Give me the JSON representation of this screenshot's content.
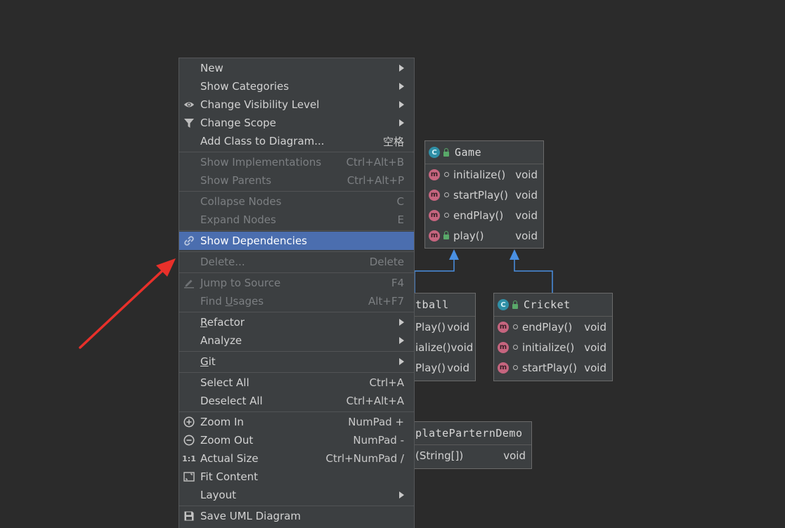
{
  "diagram": {
    "classes": {
      "game": {
        "type_icon": "C",
        "name": "Game",
        "methods": [
          {
            "name": "initialize()",
            "type": "void"
          },
          {
            "name": "startPlay()",
            "type": "void"
          },
          {
            "name": "endPlay()",
            "type": "void"
          },
          {
            "name": "play()",
            "type": "void"
          }
        ]
      },
      "football": {
        "name": "tball",
        "methods": [
          {
            "name": "Play()",
            "type": "void"
          },
          {
            "name": "ialize()",
            "type": "void"
          },
          {
            "name": "Play()",
            "type": "void"
          }
        ]
      },
      "cricket": {
        "type_icon": "C",
        "name": "Cricket",
        "methods": [
          {
            "name": "endPlay()",
            "type": "void"
          },
          {
            "name": "initialize()",
            "type": "void"
          },
          {
            "name": "startPlay()",
            "type": "void"
          }
        ]
      },
      "demo": {
        "name": "plateParternDemo",
        "methods": [
          {
            "name": "(String[])",
            "type": "void"
          }
        ]
      }
    },
    "method_icon": "m",
    "colors": {
      "background": "#2b2b2b",
      "box": "#3c3f41",
      "class_icon": "#2f8fa6",
      "method_icon": "#c6657f",
      "inherit_arrow": "#4a90e2"
    }
  },
  "menu": {
    "colors": {
      "background": "#3c3f41",
      "selected": "#4b6eaf",
      "disabled_text": "#7c7f82"
    },
    "items": {
      "new": {
        "label": "New"
      },
      "show_categories": {
        "label": "Show Categories"
      },
      "change_visibility": {
        "label": "Change Visibility Level",
        "icon": "eye-icon"
      },
      "change_scope": {
        "label": "Change Scope",
        "icon": "filter-icon"
      },
      "add_class": {
        "label": "Add Class to Diagram...",
        "shortcut": "空格"
      },
      "show_implementations": {
        "label": "Show Implementations",
        "shortcut": "Ctrl+Alt+B"
      },
      "show_parents": {
        "label": "Show Parents",
        "shortcut": "Ctrl+Alt+P"
      },
      "collapse_nodes": {
        "label": "Collapse Nodes",
        "shortcut": "C"
      },
      "expand_nodes": {
        "label": "Expand Nodes",
        "shortcut": "E"
      },
      "show_dependencies": {
        "label": "Show Dependencies",
        "icon": "link-icon"
      },
      "delete": {
        "label": "Delete...",
        "shortcut": "Delete"
      },
      "jump_to_source": {
        "label": "Jump to Source",
        "shortcut": "F4",
        "icon": "pencil-icon"
      },
      "find_usages": {
        "label_pre": "Find ",
        "label_u": "U",
        "label_post": "sages",
        "shortcut": "Alt+F7"
      },
      "refactor": {
        "label_u": "R",
        "label_post": "efactor"
      },
      "analyze": {
        "label": "Analyze"
      },
      "git": {
        "label_u": "G",
        "label_post": "it"
      },
      "select_all": {
        "label": "Select All",
        "shortcut": "Ctrl+A"
      },
      "deselect_all": {
        "label": "Deselect All",
        "shortcut": "Ctrl+Alt+A"
      },
      "zoom_in": {
        "label": "Zoom In",
        "shortcut": "NumPad +",
        "icon": "zoom-in-icon"
      },
      "zoom_out": {
        "label": "Zoom Out",
        "shortcut": "NumPad -",
        "icon": "zoom-out-icon"
      },
      "actual_size": {
        "label": "Actual Size",
        "shortcut": "Ctrl+NumPad /",
        "icon_text": "1:1"
      },
      "fit_content": {
        "label": "Fit Content",
        "icon": "fit-content-icon"
      },
      "layout": {
        "label": "Layout"
      },
      "save_uml": {
        "label": "Save UML Diagram",
        "icon": "save-icon"
      }
    }
  },
  "annotation": {
    "arrow_color": "#e8302a"
  }
}
